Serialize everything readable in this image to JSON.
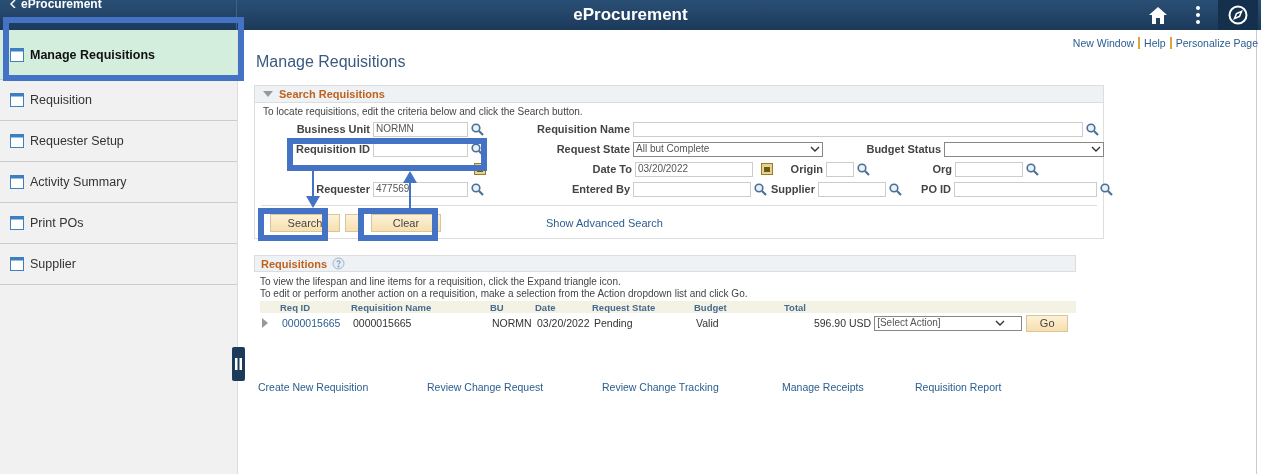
{
  "header": {
    "back_label": "eProcurement",
    "title": "eProcurement"
  },
  "sidebar": {
    "items": [
      {
        "label": "Manage Requisitions",
        "selected": true
      },
      {
        "label": "Requisition",
        "selected": false
      },
      {
        "label": "Requester Setup",
        "selected": false
      },
      {
        "label": "Activity Summary",
        "selected": false
      },
      {
        "label": "Print POs",
        "selected": false
      },
      {
        "label": "Supplier",
        "selected": false
      }
    ]
  },
  "page_links": [
    "New Window",
    "Help",
    "Personalize Page"
  ],
  "page_title": "Manage Requisitions",
  "search": {
    "heading": "Search Requisitions",
    "expanded": true,
    "instructions": "To locate requisitions, edit the criteria below and click the Search button.",
    "business_unit": {
      "label": "Business Unit",
      "value": "NORMN"
    },
    "requisition_id": {
      "label": "Requisition ID"
    },
    "requester": {
      "label": "Requester",
      "value": "477569"
    },
    "requisition_name": {
      "label": "Requisition Name"
    },
    "request_state": {
      "label": "Request State",
      "value": "All but Complete"
    },
    "budget_status": {
      "label": "Budget Status"
    },
    "date_to": {
      "label": "Date To",
      "value": "03/20/2022"
    },
    "origin": {
      "label": "Origin"
    },
    "org": {
      "label": "Org"
    },
    "entered_by": {
      "label": "Entered By"
    },
    "supplier": {
      "label": "Supplier"
    },
    "po_id": {
      "label": "PO ID"
    },
    "buttons": [
      "Search",
      "Clear"
    ],
    "advanced_link": "Show Advanced Search"
  },
  "requisitions": {
    "heading": "Requisitions",
    "instructions": [
      "To view the lifespan and line items for a requisition, click the Expand triangle icon.",
      "To edit or perform another action on a requisition, make a selection from the Action dropdown list and click Go."
    ],
    "columns": [
      "Req ID",
      "Requisition Name",
      "BU",
      "Date",
      "Request State",
      "Budget",
      "Total"
    ],
    "rows": [
      {
        "req_id": "0000015665",
        "name": "0000015665",
        "bu": "NORMN",
        "date": "03/20/2022",
        "state": "Pending",
        "budget": "Valid",
        "total": "596.90",
        "currency": "USD",
        "action": "[Select Action]",
        "go": "Go"
      }
    ]
  },
  "footer_links": [
    "Create New Requisition",
    "Review Change Request",
    "Review Change Tracking",
    "Manage Receipts",
    "Requisition Report"
  ]
}
